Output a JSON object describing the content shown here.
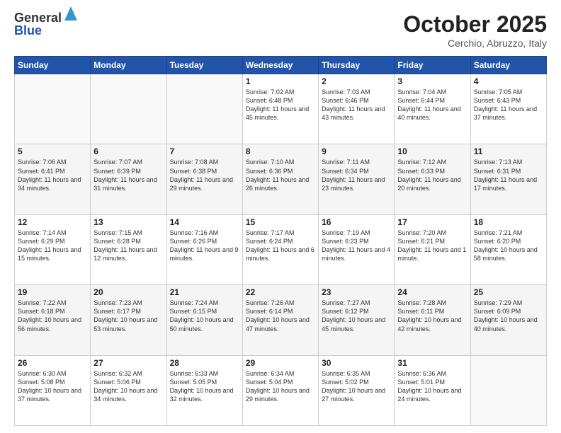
{
  "header": {
    "logo_line1": "General",
    "logo_line2": "Blue",
    "month": "October 2025",
    "location": "Cerchio, Abruzzo, Italy"
  },
  "weekdays": [
    "Sunday",
    "Monday",
    "Tuesday",
    "Wednesday",
    "Thursday",
    "Friday",
    "Saturday"
  ],
  "weeks": [
    [
      {
        "day": "",
        "info": ""
      },
      {
        "day": "",
        "info": ""
      },
      {
        "day": "",
        "info": ""
      },
      {
        "day": "1",
        "info": "Sunrise: 7:02 AM\nSunset: 6:48 PM\nDaylight: 11 hours and 45 minutes."
      },
      {
        "day": "2",
        "info": "Sunrise: 7:03 AM\nSunset: 6:46 PM\nDaylight: 11 hours and 43 minutes."
      },
      {
        "day": "3",
        "info": "Sunrise: 7:04 AM\nSunset: 6:44 PM\nDaylight: 11 hours and 40 minutes."
      },
      {
        "day": "4",
        "info": "Sunrise: 7:05 AM\nSunset: 6:43 PM\nDaylight: 11 hours and 37 minutes."
      }
    ],
    [
      {
        "day": "5",
        "info": "Sunrise: 7:06 AM\nSunset: 6:41 PM\nDaylight: 11 hours and 34 minutes."
      },
      {
        "day": "6",
        "info": "Sunrise: 7:07 AM\nSunset: 6:39 PM\nDaylight: 11 hours and 31 minutes."
      },
      {
        "day": "7",
        "info": "Sunrise: 7:08 AM\nSunset: 6:38 PM\nDaylight: 11 hours and 29 minutes."
      },
      {
        "day": "8",
        "info": "Sunrise: 7:10 AM\nSunset: 6:36 PM\nDaylight: 11 hours and 26 minutes."
      },
      {
        "day": "9",
        "info": "Sunrise: 7:11 AM\nSunset: 6:34 PM\nDaylight: 11 hours and 23 minutes."
      },
      {
        "day": "10",
        "info": "Sunrise: 7:12 AM\nSunset: 6:33 PM\nDaylight: 11 hours and 20 minutes."
      },
      {
        "day": "11",
        "info": "Sunrise: 7:13 AM\nSunset: 6:31 PM\nDaylight: 11 hours and 17 minutes."
      }
    ],
    [
      {
        "day": "12",
        "info": "Sunrise: 7:14 AM\nSunset: 6:29 PM\nDaylight: 11 hours and 15 minutes."
      },
      {
        "day": "13",
        "info": "Sunrise: 7:15 AM\nSunset: 6:28 PM\nDaylight: 11 hours and 12 minutes."
      },
      {
        "day": "14",
        "info": "Sunrise: 7:16 AM\nSunset: 6:26 PM\nDaylight: 11 hours and 9 minutes."
      },
      {
        "day": "15",
        "info": "Sunrise: 7:17 AM\nSunset: 6:24 PM\nDaylight: 11 hours and 6 minutes."
      },
      {
        "day": "16",
        "info": "Sunrise: 7:19 AM\nSunset: 6:23 PM\nDaylight: 11 hours and 4 minutes."
      },
      {
        "day": "17",
        "info": "Sunrise: 7:20 AM\nSunset: 6:21 PM\nDaylight: 11 hours and 1 minute."
      },
      {
        "day": "18",
        "info": "Sunrise: 7:21 AM\nSunset: 6:20 PM\nDaylight: 10 hours and 58 minutes."
      }
    ],
    [
      {
        "day": "19",
        "info": "Sunrise: 7:22 AM\nSunset: 6:18 PM\nDaylight: 10 hours and 56 minutes."
      },
      {
        "day": "20",
        "info": "Sunrise: 7:23 AM\nSunset: 6:17 PM\nDaylight: 10 hours and 53 minutes."
      },
      {
        "day": "21",
        "info": "Sunrise: 7:24 AM\nSunset: 6:15 PM\nDaylight: 10 hours and 50 minutes."
      },
      {
        "day": "22",
        "info": "Sunrise: 7:26 AM\nSunset: 6:14 PM\nDaylight: 10 hours and 47 minutes."
      },
      {
        "day": "23",
        "info": "Sunrise: 7:27 AM\nSunset: 6:12 PM\nDaylight: 10 hours and 45 minutes."
      },
      {
        "day": "24",
        "info": "Sunrise: 7:28 AM\nSunset: 6:11 PM\nDaylight: 10 hours and 42 minutes."
      },
      {
        "day": "25",
        "info": "Sunrise: 7:29 AM\nSunset: 6:09 PM\nDaylight: 10 hours and 40 minutes."
      }
    ],
    [
      {
        "day": "26",
        "info": "Sunrise: 6:30 AM\nSunset: 5:08 PM\nDaylight: 10 hours and 37 minutes."
      },
      {
        "day": "27",
        "info": "Sunrise: 6:32 AM\nSunset: 5:06 PM\nDaylight: 10 hours and 34 minutes."
      },
      {
        "day": "28",
        "info": "Sunrise: 6:33 AM\nSunset: 5:05 PM\nDaylight: 10 hours and 32 minutes."
      },
      {
        "day": "29",
        "info": "Sunrise: 6:34 AM\nSunset: 5:04 PM\nDaylight: 10 hours and 29 minutes."
      },
      {
        "day": "30",
        "info": "Sunrise: 6:35 AM\nSunset: 5:02 PM\nDaylight: 10 hours and 27 minutes."
      },
      {
        "day": "31",
        "info": "Sunrise: 6:36 AM\nSunset: 5:01 PM\nDaylight: 10 hours and 24 minutes."
      },
      {
        "day": "",
        "info": ""
      }
    ]
  ]
}
